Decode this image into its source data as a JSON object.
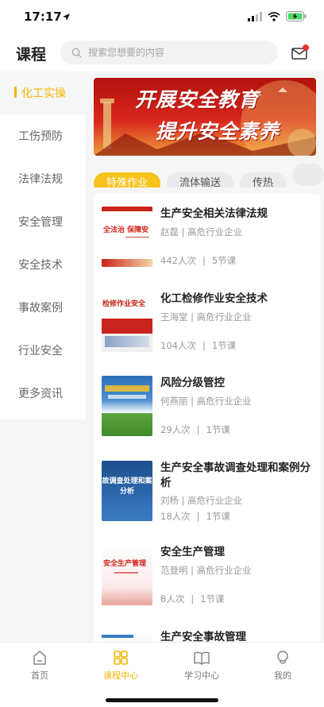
{
  "status_bar": {
    "time": "17:17"
  },
  "header": {
    "title": "课程",
    "search_placeholder": "搜索您想要的内容"
  },
  "banner": {
    "line1": "开展安全教育",
    "line2": "提升安全素养"
  },
  "sidebar": {
    "items": [
      {
        "label": "化工实操",
        "active": true
      },
      {
        "label": "工伤预防"
      },
      {
        "label": "法律法规"
      },
      {
        "label": "安全管理"
      },
      {
        "label": "安全技术"
      },
      {
        "label": "事故案例"
      },
      {
        "label": "行业安全"
      },
      {
        "label": "更多资讯"
      }
    ]
  },
  "chips": [
    {
      "label": "特殊作业",
      "active": true
    },
    {
      "label": "流体输送"
    },
    {
      "label": "传热"
    }
  ],
  "courses": [
    {
      "title": "生产安全相关法律法规",
      "meta": "赵磊 | 高危行业企业",
      "views": "442人次",
      "lessons": "5节课",
      "thumb_text": "全法治  保障安"
    },
    {
      "title": "化工检修作业安全技术",
      "meta": "王海堂 | 高危行业企业",
      "views": "104人次",
      "lessons": "1节课",
      "thumb_text": "检修作业安全"
    },
    {
      "title": "风险分级管控",
      "meta": "何燕丽 | 高危行业企业",
      "views": "29人次",
      "lessons": "1节课",
      "thumb_text": ""
    },
    {
      "title": "生产安全事故调查处理和案例分析",
      "meta": "刘杨 | 高危行业企业",
      "views": "18人次",
      "lessons": "1节课",
      "thumb_text": "故调查处理和案分析"
    },
    {
      "title": "安全生产管理",
      "meta": "范登明 | 高危行业企业",
      "views": "8人次",
      "lessons": "1节课",
      "thumb_text": "安全生产管理"
    },
    {
      "title": "生产安全事故管理",
      "meta": "",
      "views": "",
      "lessons": "",
      "thumb_text": ""
    }
  ],
  "tabs": [
    {
      "label": "首页",
      "icon": "home-icon"
    },
    {
      "label": "课程中心",
      "icon": "grid-icon",
      "active": true
    },
    {
      "label": "学习中心",
      "icon": "book-icon"
    },
    {
      "label": "我的",
      "icon": "user-icon"
    }
  ],
  "colors": {
    "accent": "#f3b500",
    "chip_active": "#f7c21a",
    "background": "#f6f6f6"
  }
}
